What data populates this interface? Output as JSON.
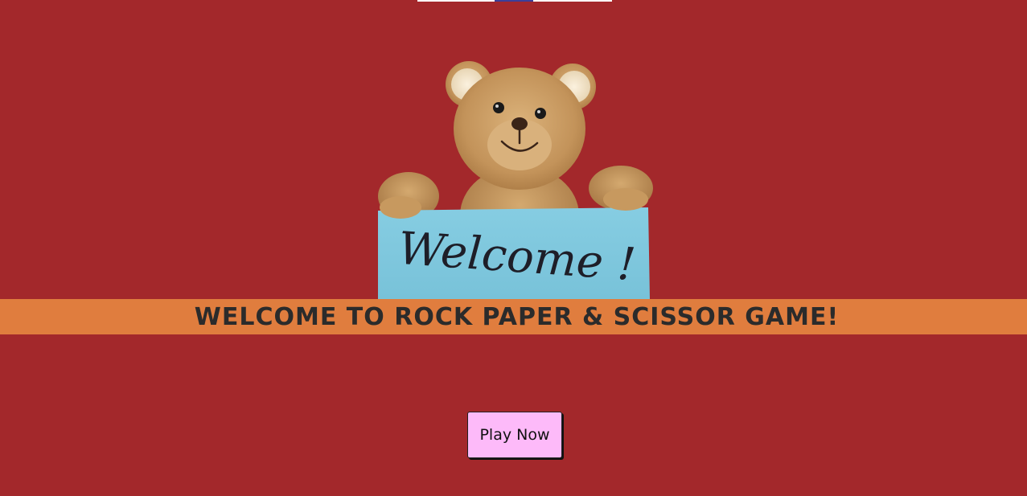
{
  "page": {
    "background_color": "#a3282b"
  },
  "welcome_image": {
    "sign_text": "Welcome !",
    "sign_color": "#7fc7dd",
    "bear_color": "#c89b62"
  },
  "banner": {
    "title": "WELCOME TO ROCK PAPER & SCISSOR GAME!",
    "background_color": "#e07d3e"
  },
  "play_button": {
    "label": "Play Now",
    "background_color": "#fdbaf9"
  }
}
